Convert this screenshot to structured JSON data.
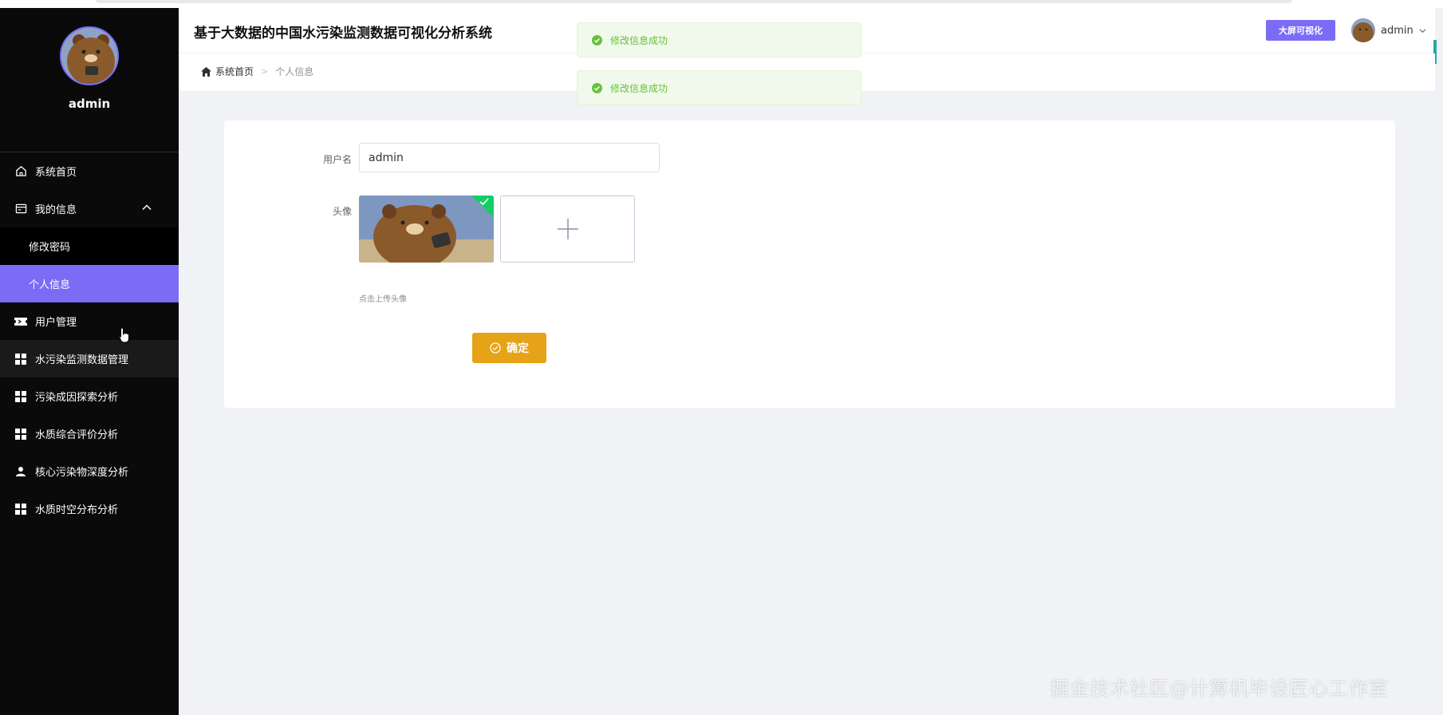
{
  "app": {
    "title": "基于大数据的中国水污染监测数据可视化分析系统",
    "bigscreen_label": "大屏可视化",
    "user_name": "admin"
  },
  "sidebar": {
    "profile_name": "admin",
    "items": [
      {
        "label": "系统首页",
        "icon": "home-icon"
      },
      {
        "label": "我的信息",
        "icon": "card-icon",
        "expanded": true
      },
      {
        "label": "用户管理",
        "icon": "ticket-icon"
      },
      {
        "label": "水污染监测数据管理",
        "icon": "grid-icon"
      },
      {
        "label": "污染成因探索分析",
        "icon": "grid-icon"
      },
      {
        "label": "水质综合评价分析",
        "icon": "grid-icon"
      },
      {
        "label": "核心污染物深度分析",
        "icon": "person-icon"
      },
      {
        "label": "水质时空分布分析",
        "icon": "grid-icon"
      }
    ],
    "submenu": [
      {
        "label": "修改密码"
      },
      {
        "label": "个人信息",
        "active": true
      }
    ],
    "accent_color": "#7b6cf6"
  },
  "breadcrumb": {
    "home": "系统首页",
    "current": "个人信息"
  },
  "toasts": [
    {
      "message": "修改信息成功"
    },
    {
      "message": "修改信息成功"
    }
  ],
  "form": {
    "username_label": "用户名",
    "username_value": "admin",
    "avatar_label": "头像",
    "upload_tip": "点击上传头像",
    "confirm_label": "确定",
    "confirm_color": "#e6a317"
  },
  "watermark": "掘金技术社区@计算机毕设匠心工作室"
}
